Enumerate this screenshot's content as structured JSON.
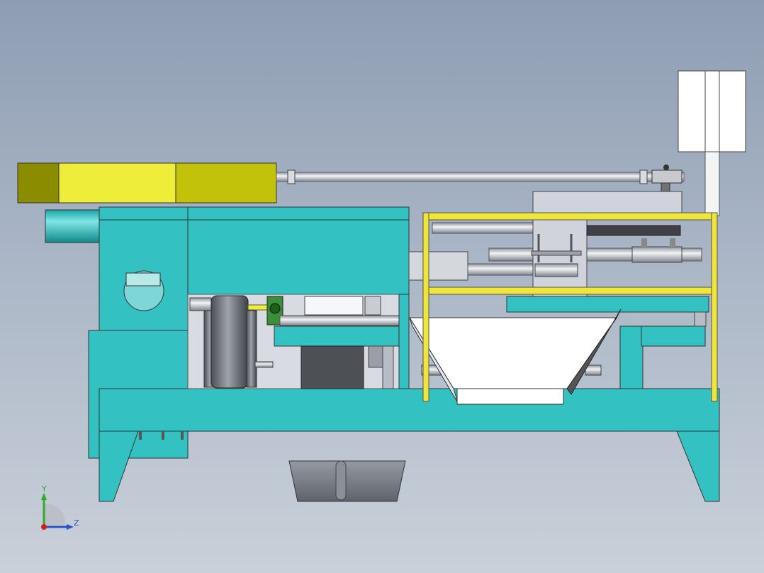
{
  "view": {
    "background_top": "#8f9db3",
    "background_bottom": "#c9d0d9"
  },
  "colors": {
    "frame_teal": "#33c1c1",
    "frame_teal_dark": "#1d9e9e",
    "motor_yellow": "#eded3a",
    "motor_olive": "#c2c20a",
    "motor_olive_dark": "#8c8c00",
    "guard_yellow": "#f0e63a",
    "metal_gray": "#b8bcc4",
    "metal_dark": "#5a5d63",
    "hopper_white": "#ffffff",
    "axis_y": "#2faa2f",
    "axis_z": "#2a52c8",
    "axis_origin": "#d22020"
  },
  "triad": {
    "y_label": "Y",
    "z_label": "Z",
    "icon": "coordinate-triad-icon"
  }
}
